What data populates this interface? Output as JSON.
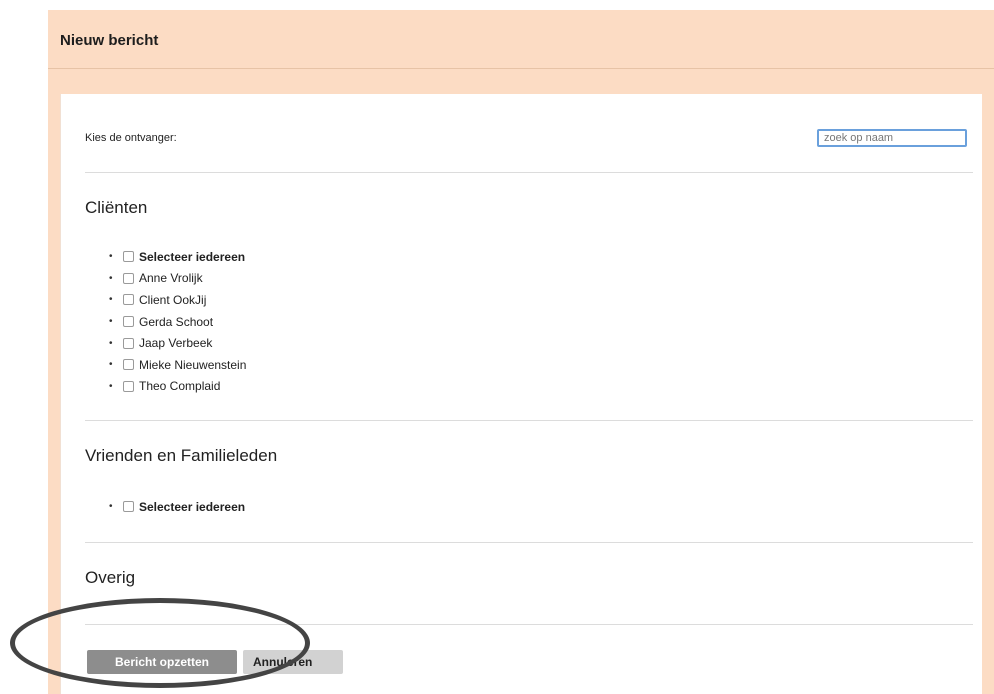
{
  "panel": {
    "title": "Nieuw bericht"
  },
  "recipient": {
    "label": "Kies de ontvanger:",
    "search_placeholder": "zoek op naam"
  },
  "sections": {
    "clients": {
      "title": "Cliënten",
      "items": [
        {
          "label": "Selecteer iedereen",
          "bold": true
        },
        {
          "label": "Anne Vrolijk",
          "bold": false
        },
        {
          "label": "Client OokJij",
          "bold": false
        },
        {
          "label": "Gerda Schoot",
          "bold": false
        },
        {
          "label": "Jaap Verbeek",
          "bold": false
        },
        {
          "label": "Mieke Nieuwenstein",
          "bold": false
        },
        {
          "label": "Theo Complaid",
          "bold": false
        }
      ]
    },
    "friends": {
      "title": "Vrienden en Familieleden",
      "items": [
        {
          "label": "Selecteer iedereen",
          "bold": true
        }
      ]
    },
    "other": {
      "title": "Overig"
    }
  },
  "actions": {
    "submit_label": "Bericht opzetten",
    "cancel_label": "Annuleren"
  },
  "colors": {
    "panel_background": "#fcdcc4",
    "primary_button": "#8d8d8d",
    "secondary_button": "#d2d2d2",
    "input_focus_border": "#6aa0dc"
  }
}
